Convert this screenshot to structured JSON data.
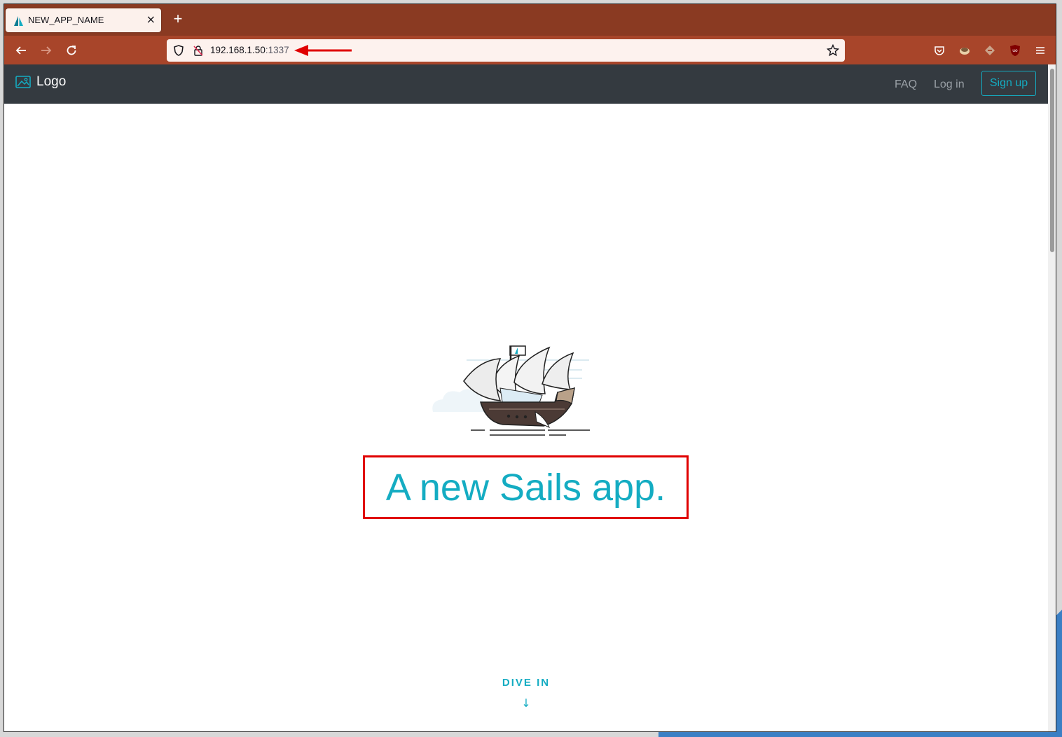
{
  "browser": {
    "tab": {
      "title": "NEW_APP_NAME",
      "close_glyph": "×"
    },
    "new_tab_glyph": "+",
    "url": {
      "host": "192.168.1.50",
      "port": ":1337"
    },
    "toolbar_icons": [
      "back-arrow-icon",
      "forward-arrow-icon",
      "reload-icon",
      "shield-icon",
      "lock-icon",
      "star-icon",
      "pocket-icon",
      "extension-icon",
      "extension-icon",
      "ublock-icon",
      "menu-icon"
    ],
    "colors": {
      "tab_strip": "#8a3a22",
      "toolbar": "#a8452a",
      "annotation": "#e00000"
    }
  },
  "page": {
    "navbar": {
      "brand": "Logo",
      "links": {
        "faq": "FAQ",
        "login": "Log in",
        "signup": "Sign up"
      }
    },
    "hero": {
      "title": "A new Sails app."
    },
    "dive_in": {
      "label": "DIVE IN",
      "arrow": "↓"
    },
    "colors": {
      "navbar": "#343a40",
      "accent": "#14acc2"
    }
  }
}
